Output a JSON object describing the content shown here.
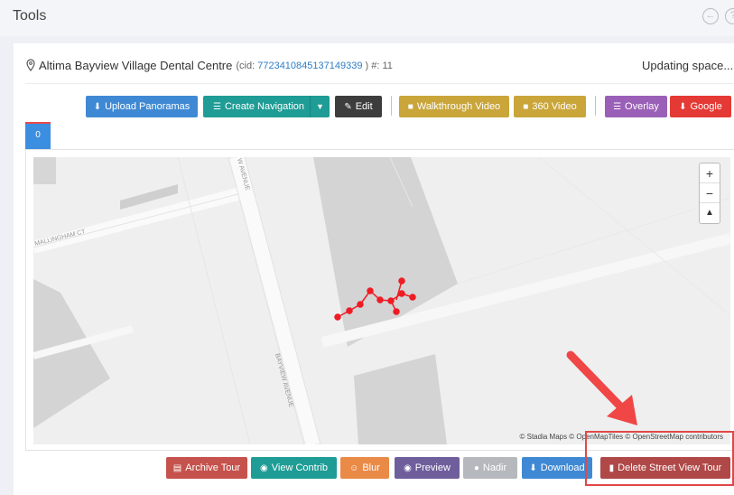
{
  "topbar": {
    "title": "Tools",
    "back_icon": "back-arrow-icon",
    "help_icon": "help-icon"
  },
  "location": {
    "name": "Altima Bayview Village Dental Centre",
    "cid_prefix": "(cid:",
    "cid": "7723410845137149339",
    "cid_suffix": ") #: 11",
    "status": "Updating space..."
  },
  "toolbar": {
    "upload_label": "Upload Panoramas",
    "create_nav_label": "Create Navigation",
    "edit_label": "Edit",
    "walkthrough_label": "Walkthrough Video",
    "video360_label": "360 Video",
    "overlay_label": "Overlay",
    "google_label": "Google"
  },
  "tabs": [
    {
      "label": "0"
    }
  ],
  "map": {
    "street_labels": [
      "W AVENUE",
      "MALLINGHAM CT",
      "BAYVIEW AVENUE"
    ],
    "attribution": "© Stadia Maps © OpenMapTiles © OpenStreetMap contributors",
    "zoom_in": "+",
    "zoom_out": "−",
    "reset": "▲"
  },
  "bottom_actions": {
    "archive_label": "Archive Tour",
    "view_contrib_label": "View Contrib",
    "blur_label": "Blur",
    "preview_label": "Preview",
    "nadir_label": "Nadir",
    "download_label": "Download",
    "delete_label": "Delete Street View Tour"
  },
  "colors": {
    "primary": "#3f89d4",
    "teal": "#1e9c95",
    "dark": "#3d3d3d",
    "gold": "#c9a53a",
    "purple": "#9a5fb7",
    "red": "#e53935",
    "archive": "#c5524c",
    "orange": "#ea8a47",
    "slate_purple": "#6f5e9c",
    "grey": "#b5b8bd",
    "delete": "#b04848",
    "marker": "#ee1c24"
  }
}
